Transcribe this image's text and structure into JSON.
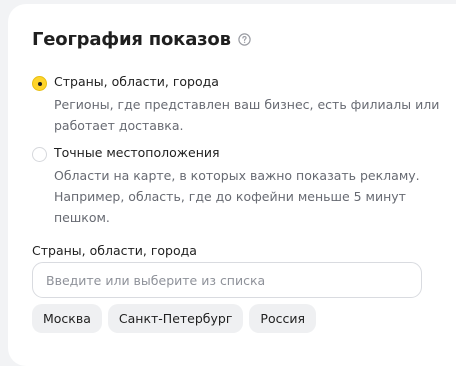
{
  "section": {
    "title": "География показов",
    "help_icon": "question-circle-icon"
  },
  "options": [
    {
      "label": "Страны, области, города",
      "description": "Регионы, где представлен ваш бизнес, есть филиалы или работает доставка.",
      "selected": true
    },
    {
      "label": "Точные местоположения",
      "description": "Области на карте, в которых важно показать рекламу. Например, область, где до кофейни меньше 5 минут пешком.",
      "selected": false
    }
  ],
  "regions": {
    "label": "Страны, области, города",
    "placeholder": "Введите или выберите из списка",
    "value": "",
    "chips": [
      "Москва",
      "Санкт-Петербург",
      "Россия"
    ]
  },
  "colors": {
    "accent": "#fed42b",
    "text": "#1f1f1f",
    "muted": "#676a72",
    "chip_bg": "#eff0f2"
  }
}
